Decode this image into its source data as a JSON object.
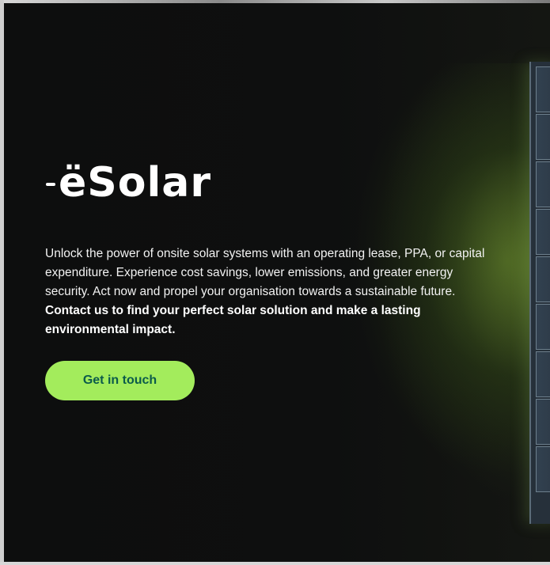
{
  "brand": {
    "logo_text": "ëSolar"
  },
  "hero": {
    "description_plain": "Unlock the power of onsite solar systems with an operating lease, PPA, or capital expenditure. Experience cost savings, lower emissions, and greater energy security. Act now and propel your organisation towards a sustainable future.",
    "description_bold": "Contact us to find your perfect solar solution and make a lasting environmental impact.",
    "cta_label": "Get in touch"
  },
  "colors": {
    "background": "#0d0e0e",
    "cta_background": "#a3ec5c",
    "cta_text": "#0b5b4b",
    "text": "#ffffff",
    "panel_glow": "#6c8f2e"
  },
  "icons": {
    "logo_mark": "esolar-logo-icon"
  }
}
